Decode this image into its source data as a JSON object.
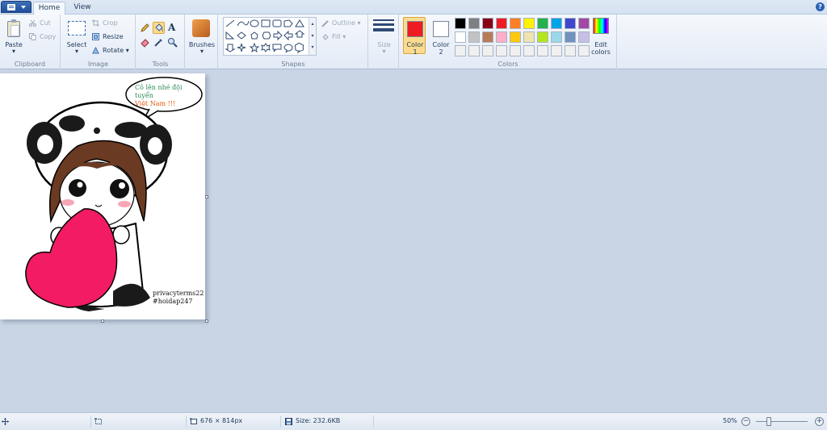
{
  "tabs": {
    "home": "Home",
    "view": "View"
  },
  "help_icon": "help-icon",
  "ribbon": {
    "clipboard": {
      "label": "Clipboard",
      "paste": "Paste",
      "cut": "Cut",
      "copy": "Copy"
    },
    "image": {
      "label": "Image",
      "select": "Select",
      "crop": "Crop",
      "resize": "Resize",
      "rotate": "Rotate"
    },
    "tools": {
      "label": "Tools",
      "active_tool": "fill-with-color"
    },
    "brushes": {
      "label": "Brushes"
    },
    "shapes": {
      "label": "Shapes",
      "outline": "Outline",
      "fill": "Fill"
    },
    "size": {
      "label": "Size"
    },
    "colors": {
      "label": "Colors",
      "color1_label": "Color",
      "color1_num": "1",
      "color2_label": "Color",
      "color2_num": "2",
      "edit_label": "Edit",
      "edit_label2": "colors",
      "color1_value": "#ed1c24",
      "color2_value": "#ffffff",
      "palette_row1": [
        "#000000",
        "#7f7f7f",
        "#880015",
        "#ed1c24",
        "#ff7f27",
        "#fff200",
        "#22b14c",
        "#00a2e8",
        "#3f48cc",
        "#a349a4"
      ],
      "palette_row2": [
        "#ffffff",
        "#c3c3c3",
        "#b97a57",
        "#ffaec9",
        "#ffc90e",
        "#efe4b0",
        "#b5e61d",
        "#99d9ea",
        "#7092be",
        "#c8bfe7"
      ],
      "palette_row3": [
        "#f0f0f0",
        "#f0f0f0",
        "#f0f0f0",
        "#f0f0f0",
        "#f0f0f0",
        "#f0f0f0",
        "#f0f0f0",
        "#f0f0f0",
        "#f0f0f0",
        "#f0f0f0"
      ]
    }
  },
  "canvas": {
    "speech_line1": "Cô lên nhé đội tuyển",
    "speech_line2": "Việt Nam !!!",
    "watermark_line1": "privacyterms22",
    "watermark_line2": "#hoidap247"
  },
  "status": {
    "dimensions": "676 × 814px",
    "size": "Size: 232.6KB",
    "zoom": "50%",
    "zoom_level": 0.5
  }
}
